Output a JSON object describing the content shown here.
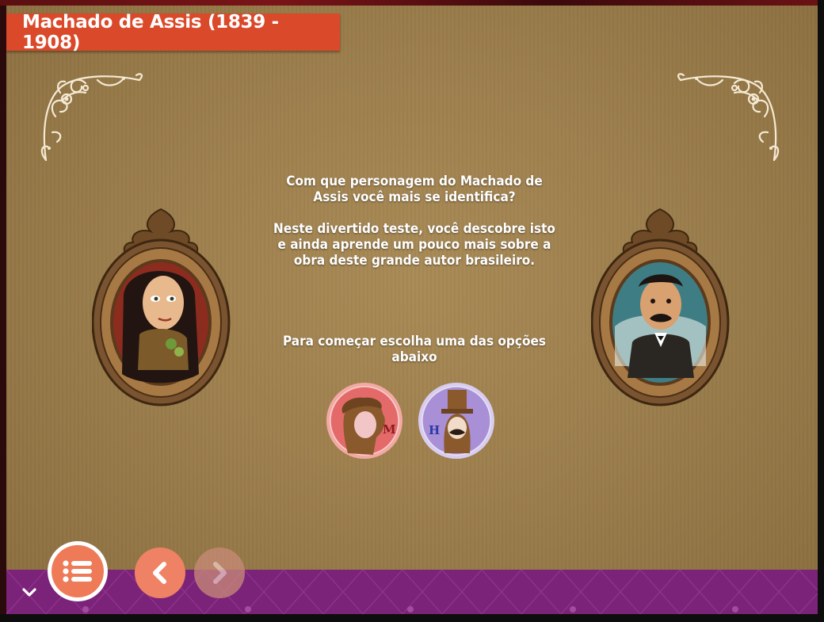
{
  "header": {
    "title": "Machado de Assis (1839 - 1908)"
  },
  "intro": {
    "question": "Com que personagem do Machado de Assis você mais se identifica?",
    "description": "Neste divertido teste, você descobre isto e ainda aprende um pouco mais sobre a obra deste grande autor brasileiro.",
    "prompt": "Para começar escolha uma das opções abaixo"
  },
  "options": [
    {
      "letter": "M",
      "color": "#e46a6a"
    },
    {
      "letter": "H",
      "color": "#a98fd6"
    }
  ],
  "colors": {
    "banner": "#d9492a",
    "footer": "#7b2379",
    "nav_button": "#ef8264"
  },
  "icons": {
    "menu": "list-icon",
    "prev": "chevron-left-icon",
    "next": "chevron-right-icon",
    "collapse": "chevron-down-icon"
  }
}
